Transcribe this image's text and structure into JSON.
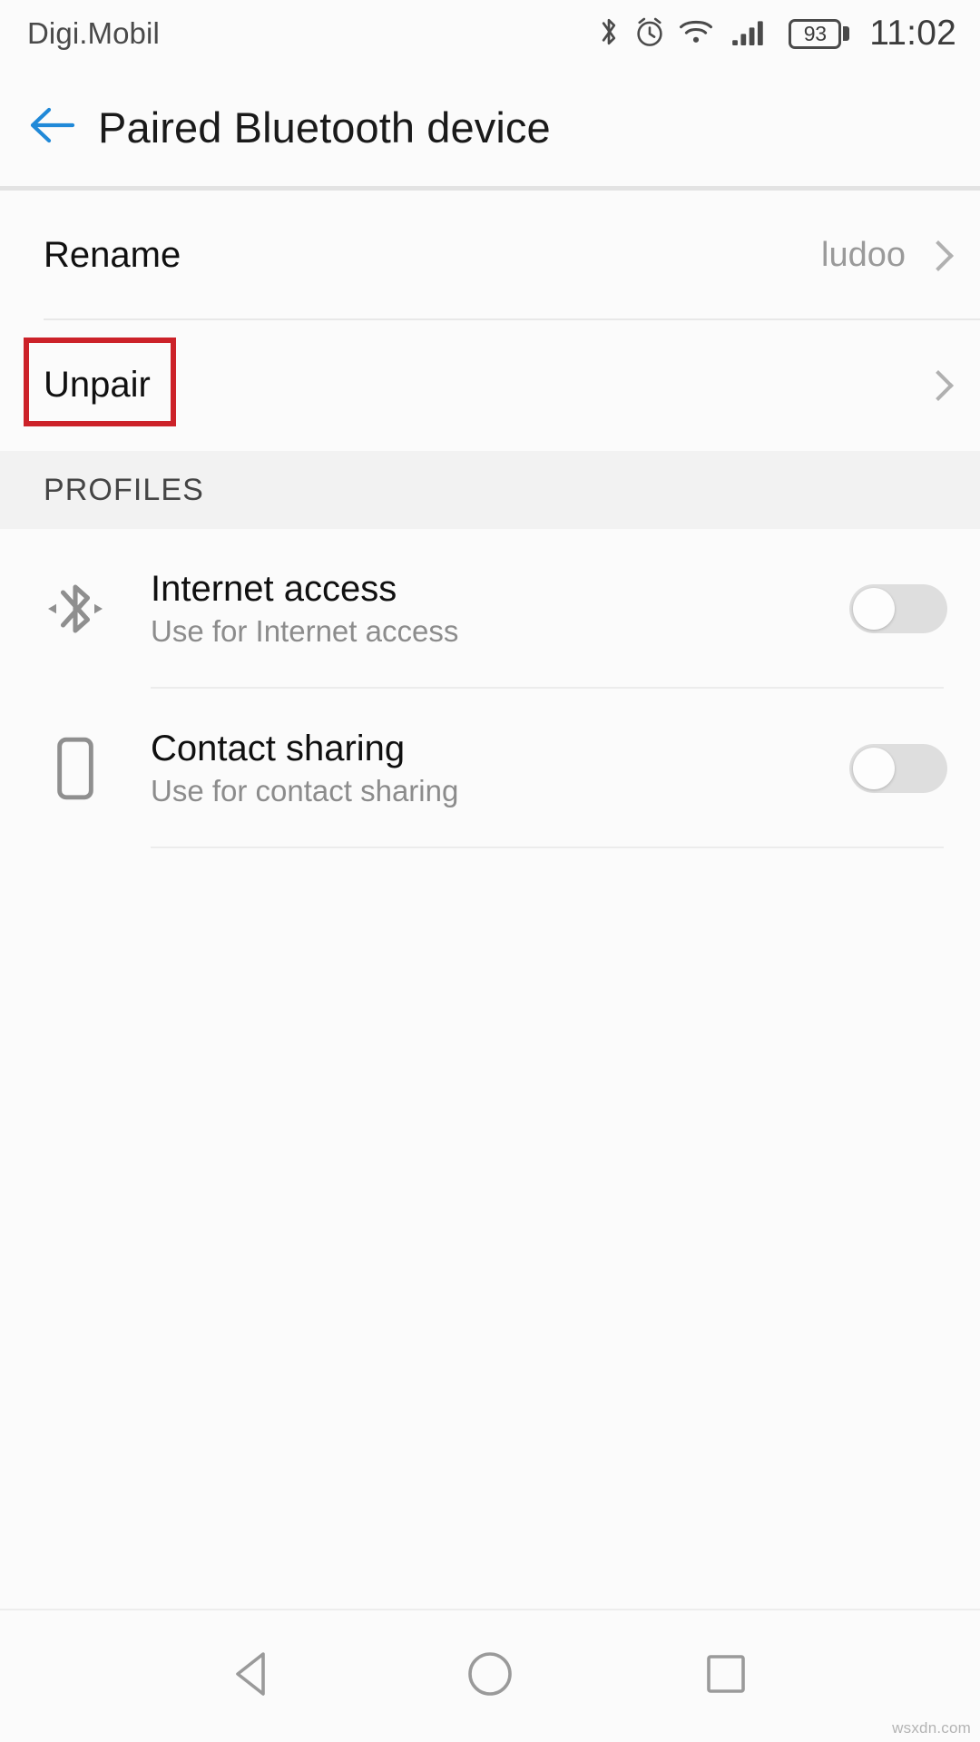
{
  "status_bar": {
    "carrier": "Digi.Mobil",
    "battery_level": "93",
    "time": "11:02",
    "icons": [
      "bluetooth-icon",
      "alarm-icon",
      "wifi-icon",
      "cellular-signal-icon",
      "battery-icon"
    ]
  },
  "header": {
    "title": "Paired Bluetooth device",
    "back_icon": "back-arrow-icon",
    "accent_color": "#2089d8"
  },
  "settings_rows": [
    {
      "label": "Rename",
      "value": "ludoo",
      "chevron": "chevron-right-icon"
    },
    {
      "label": "Unpair",
      "value": "",
      "chevron": "chevron-right-icon",
      "highlighted": true
    }
  ],
  "annotation": {
    "target": "Unpair",
    "color": "#cc2229"
  },
  "section": {
    "title": "PROFILES"
  },
  "profiles": [
    {
      "icon": "bluetooth-tethering-icon",
      "title": "Internet access",
      "subtitle": "Use for Internet access",
      "toggle_state": "off"
    },
    {
      "icon": "phone-outline-icon",
      "title": "Contact sharing",
      "subtitle": "Use for contact sharing",
      "toggle_state": "off"
    }
  ],
  "nav_bar": {
    "buttons": [
      {
        "name": "back-triangle-icon",
        "label": "Back"
      },
      {
        "name": "home-circle-icon",
        "label": "Home"
      },
      {
        "name": "recents-square-icon",
        "label": "Recents"
      }
    ]
  },
  "watermark": "wsxdn.com"
}
